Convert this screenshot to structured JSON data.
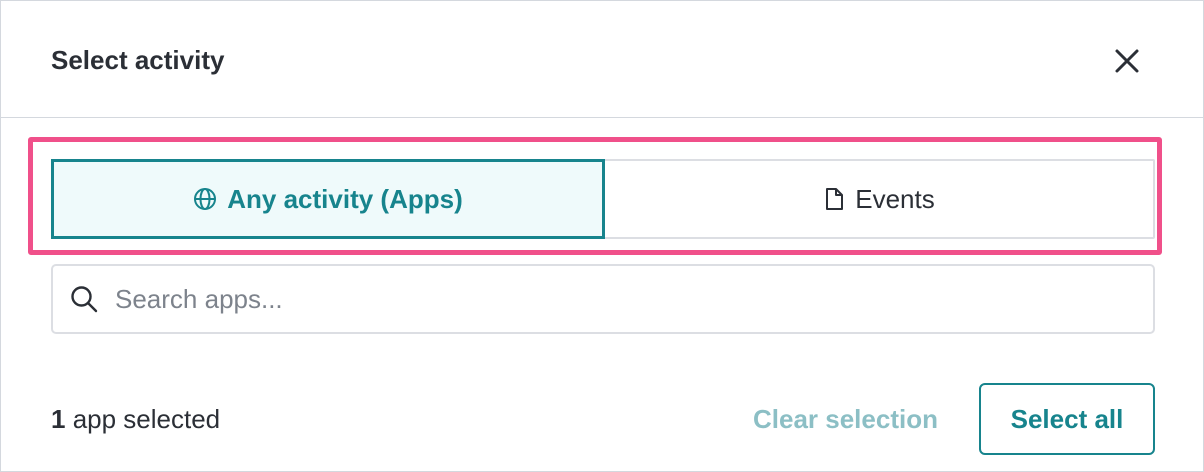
{
  "dialog": {
    "title": "Select activity"
  },
  "tabs": [
    {
      "label": "Any activity (Apps)",
      "icon": "globe-icon",
      "active": true
    },
    {
      "label": "Events",
      "icon": "document-icon",
      "active": false
    }
  ],
  "search": {
    "placeholder": "Search apps...",
    "value": ""
  },
  "footer": {
    "count": "1",
    "count_suffix": " app selected",
    "clear_label": "Clear selection",
    "select_all_label": "Select all"
  },
  "colors": {
    "accent": "#17848d",
    "accent_light": "#effafb",
    "disabled_link": "#8cbfc5",
    "highlight": "#f0508a",
    "text": "#2b2f36",
    "border": "#dcdee3"
  }
}
